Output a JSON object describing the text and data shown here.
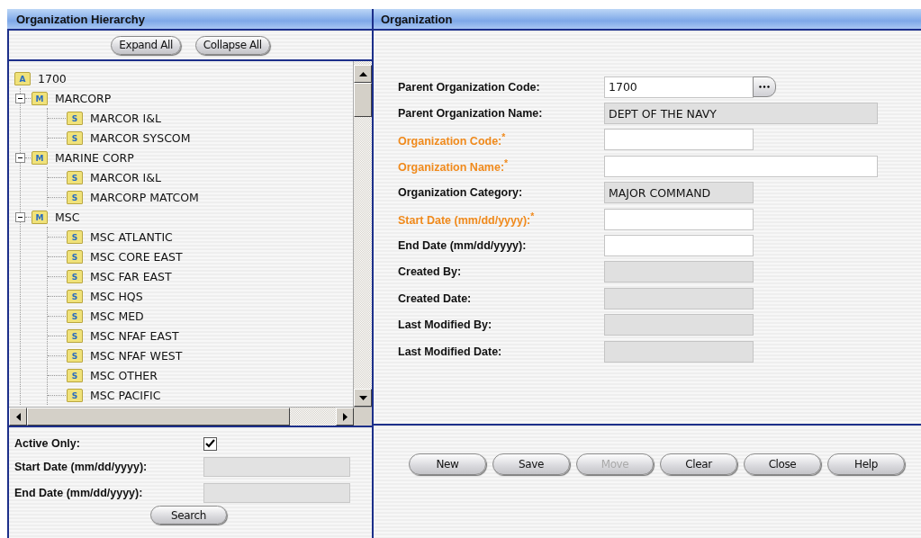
{
  "left_panel": {
    "title": "Organization Hierarchy",
    "buttons": [
      {
        "label": "Expand All"
      },
      {
        "label": "Collapse All"
      }
    ],
    "tree": [
      {
        "label": "1700",
        "badge": "A",
        "children": [
          {
            "label": "MARCORP",
            "badge": "M",
            "expanded": true,
            "children": [
              {
                "label": "MARCOR I&L",
                "badge": "S"
              },
              {
                "label": "MARCOR SYSCOM",
                "badge": "S"
              }
            ]
          },
          {
            "label": "MARINE CORP",
            "badge": "M",
            "expanded": true,
            "children": [
              {
                "label": "MARCOR I&L",
                "badge": "S"
              },
              {
                "label": "MARCORP MATCOM",
                "badge": "S"
              }
            ]
          },
          {
            "label": "MSC",
            "badge": "M",
            "expanded": true,
            "children": [
              {
                "label": "MSC ATLANTIC",
                "badge": "S"
              },
              {
                "label": "MSC CORE EAST",
                "badge": "S"
              },
              {
                "label": "MSC FAR EAST",
                "badge": "S"
              },
              {
                "label": "MSC HQS",
                "badge": "S"
              },
              {
                "label": "MSC MED",
                "badge": "S"
              },
              {
                "label": "MSC NFAF EAST",
                "badge": "S"
              },
              {
                "label": "MSC NFAF WEST",
                "badge": "S"
              },
              {
                "label": "MSC OTHER",
                "badge": "S"
              },
              {
                "label": "MSC PACIFIC",
                "badge": "S"
              }
            ]
          }
        ]
      }
    ],
    "filters": {
      "active_only": {
        "label": "Active Only:",
        "checked": true
      },
      "fields": [
        {
          "label": "Start Date (mm/dd/yyyy):",
          "disabled": true
        },
        {
          "label": "End Date (mm/dd/yyyy):",
          "disabled": true
        }
      ],
      "search_button": "Search"
    }
  },
  "right_panel": {
    "title": "Organization",
    "fields": [
      {
        "label": "Parent Organization Code:",
        "value": "1700",
        "kind": "lookup",
        "required": false,
        "wide": false,
        "readonly": false
      },
      {
        "label": "Parent Organization Name:",
        "value": "DEPT OF THE NAVY",
        "kind": "text",
        "required": false,
        "wide": true,
        "readonly": true
      },
      {
        "label": "Organization Code:$^{*}$",
        "kind": "text",
        "required": true,
        "wide": false,
        "readonly": false
      },
      {
        "label": "Organization Name:$^{*}$",
        "kind": "text",
        "required": true,
        "wide": true,
        "readonly": false
      },
      {
        "label": "Organization Category:",
        "value": "MAJOR COMMAND",
        "kind": "text",
        "required": false,
        "wide": false,
        "readonly": true
      },
      {
        "label": "Start Date (mm/dd/yyyy):$^{*}$",
        "kind": "text",
        "required": true,
        "wide": false,
        "readonly": false
      },
      {
        "label": "End Date (mm/dd/yyyy):",
        "kind": "text",
        "required": false,
        "wide": false,
        "readonly": false
      },
      {
        "label": "Created By:",
        "kind": "text",
        "required": false,
        "wide": false,
        "readonly": true
      },
      {
        "label": "Created Date:",
        "kind": "text",
        "required": false,
        "wide": false,
        "readonly": true
      },
      {
        "label": "Last Modified By:",
        "kind": "text",
        "required": false,
        "wide": false,
        "readonly": true
      },
      {
        "label": "Last Modified Date:",
        "kind": "text",
        "required": false,
        "wide": false,
        "readonly": true
      }
    ],
    "buttons": [
      {
        "label": "New",
        "disabled": false
      },
      {
        "label": "Save",
        "disabled": false
      },
      {
        "label": "Move",
        "disabled": true
      },
      {
        "label": "Clear",
        "disabled": false
      },
      {
        "label": "Close",
        "disabled": false
      },
      {
        "label": "Help",
        "disabled": false
      }
    ]
  }
}
